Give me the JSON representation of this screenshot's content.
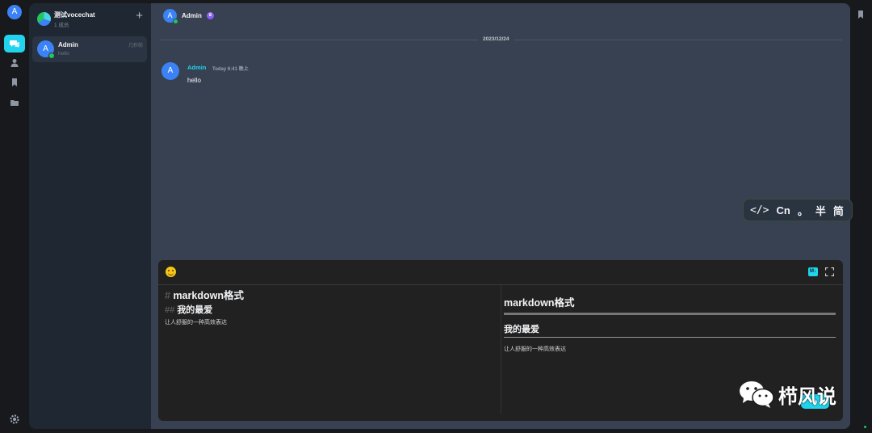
{
  "user": {
    "avatar_letter": "A"
  },
  "server": {
    "name": "测试vocechat",
    "members": "1 成员"
  },
  "sessions": [
    {
      "name": "Admin",
      "avatar_letter": "A",
      "last_message": "hello",
      "time": "几秒前"
    }
  ],
  "header": {
    "name": "Admin",
    "avatar_letter": "A"
  },
  "date_divider": "2023/12/24",
  "messages": [
    {
      "author": "Admin",
      "avatar_letter": "A",
      "time": "Today 6:41 晚上",
      "text": "hello"
    }
  ],
  "editor": {
    "source": {
      "h1_mark": "#",
      "h1": "markdown格式",
      "h2_mark": "##",
      "h2": "我的最爱",
      "p": "让人舒服的一种高效表达"
    },
    "preview": {
      "h1": "markdown格式",
      "h2": "我的最爱",
      "p": "让人舒服的一种高效表达"
    },
    "md_toggle_label": "M↓"
  },
  "ime_bar": {
    "code": "</>",
    "lang": "Cn",
    "punct": "。",
    "width": "半",
    "script": "简"
  },
  "watermark": "栉风说",
  "colors": {
    "accent": "#22d3ee",
    "online": "#22c55e",
    "avatar": "#3b82f6",
    "main_bg": "#374151",
    "sidebar_bg": "#1f2733",
    "editor_bg": "#212121"
  },
  "icons": {
    "nav": [
      "chat-icon",
      "user-icon",
      "bookmark-icon",
      "folder-icon"
    ],
    "bottom": "gear-icon"
  }
}
